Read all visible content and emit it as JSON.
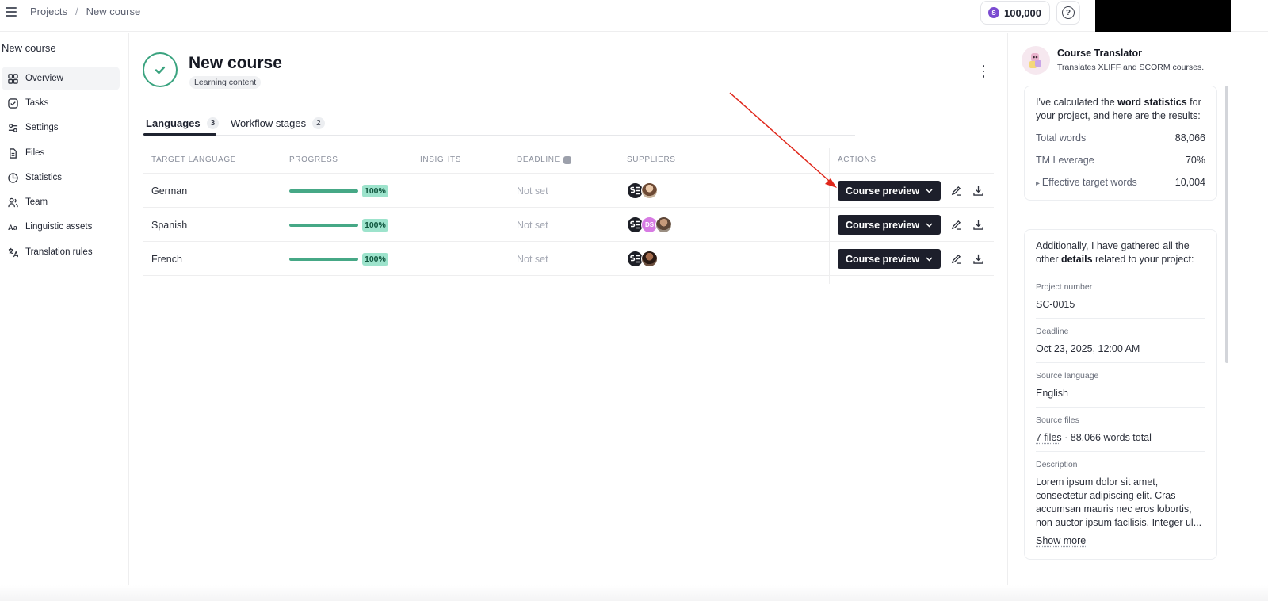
{
  "breadcrumb": {
    "root": "Projects",
    "current": "New course"
  },
  "header": {
    "credits": "100,000",
    "coin_symbol": "S",
    "help_symbol": "?"
  },
  "sidebar": {
    "title": "New course",
    "items": [
      {
        "label": "Overview",
        "icon": "grid-icon",
        "active": true
      },
      {
        "label": "Tasks",
        "icon": "check-square-icon"
      },
      {
        "label": "Settings",
        "icon": "sliders-icon"
      },
      {
        "label": "Files",
        "icon": "file-icon"
      },
      {
        "label": "Statistics",
        "icon": "pie-chart-icon"
      },
      {
        "label": "Team",
        "icon": "team-icon"
      },
      {
        "label": "Linguistic assets",
        "icon": "text-aa-icon"
      },
      {
        "label": "Translation rules",
        "icon": "translate-icon"
      }
    ]
  },
  "project": {
    "title": "New course",
    "type_badge": "Learning content"
  },
  "tabs": [
    {
      "label": "Languages",
      "count": "3",
      "active": true
    },
    {
      "label": "Workflow stages",
      "count": "2"
    }
  ],
  "table": {
    "headers": [
      "TARGET LANGUAGE",
      "PROGRESS",
      "INSIGHTS",
      "DEADLINE",
      "SUPPLIERS",
      "ACTIONS"
    ],
    "rows": [
      {
        "language": "German",
        "progress": 100,
        "progress_label": "100%",
        "deadline": "Not set",
        "suppliers": [
          "logo",
          "photo"
        ]
      },
      {
        "language": "Spanish",
        "progress": 100,
        "progress_label": "100%",
        "deadline": "Not set",
        "suppliers": [
          "logo",
          "DS",
          "photo"
        ]
      },
      {
        "language": "French",
        "progress": 100,
        "progress_label": "100%",
        "deadline": "Not set",
        "suppliers": [
          "logo",
          "photo"
        ]
      }
    ],
    "preview_label": "Course preview"
  },
  "assistant": {
    "name": "Course Translator",
    "description": "Translates XLIFF and SCORM courses.",
    "stats_intro_pre": "I've calculated the ",
    "stats_intro_bold": "word statistics",
    "stats_intro_post": " for your project, and here are the results:",
    "stats": [
      {
        "label": "Total words",
        "value": "88,066"
      },
      {
        "label": "TM Leverage",
        "value": "70%"
      },
      {
        "label": "Effective target words",
        "value": "10,004"
      }
    ],
    "details_intro_pre": "Additionally, I have gathered all the other ",
    "details_intro_bold": "details",
    "details_intro_post": " related to your project:",
    "fields": [
      {
        "label": "Project number",
        "value": "SC-0015"
      },
      {
        "label": "Deadline",
        "value": "Oct 23, 2025, 12:00 AM"
      },
      {
        "label": "Source language",
        "value": "English"
      }
    ],
    "source_files_label": "Source files",
    "source_files_link": "7 files",
    "source_files_rest": " · 88,066 words total",
    "description_label": "Description",
    "description_text": "Lorem ipsum dolor sit amet, consectetur adipiscing elit. Cras accumsan mauris nec eros lobortis, non auctor ipsum facilisis. Integer ul...",
    "show_more": "Show more"
  },
  "colors": {
    "accent": "#3aa37f",
    "progress": "#46a886",
    "button_dark": "#1d1f2b",
    "annotation_arrow": "#e0271b"
  }
}
